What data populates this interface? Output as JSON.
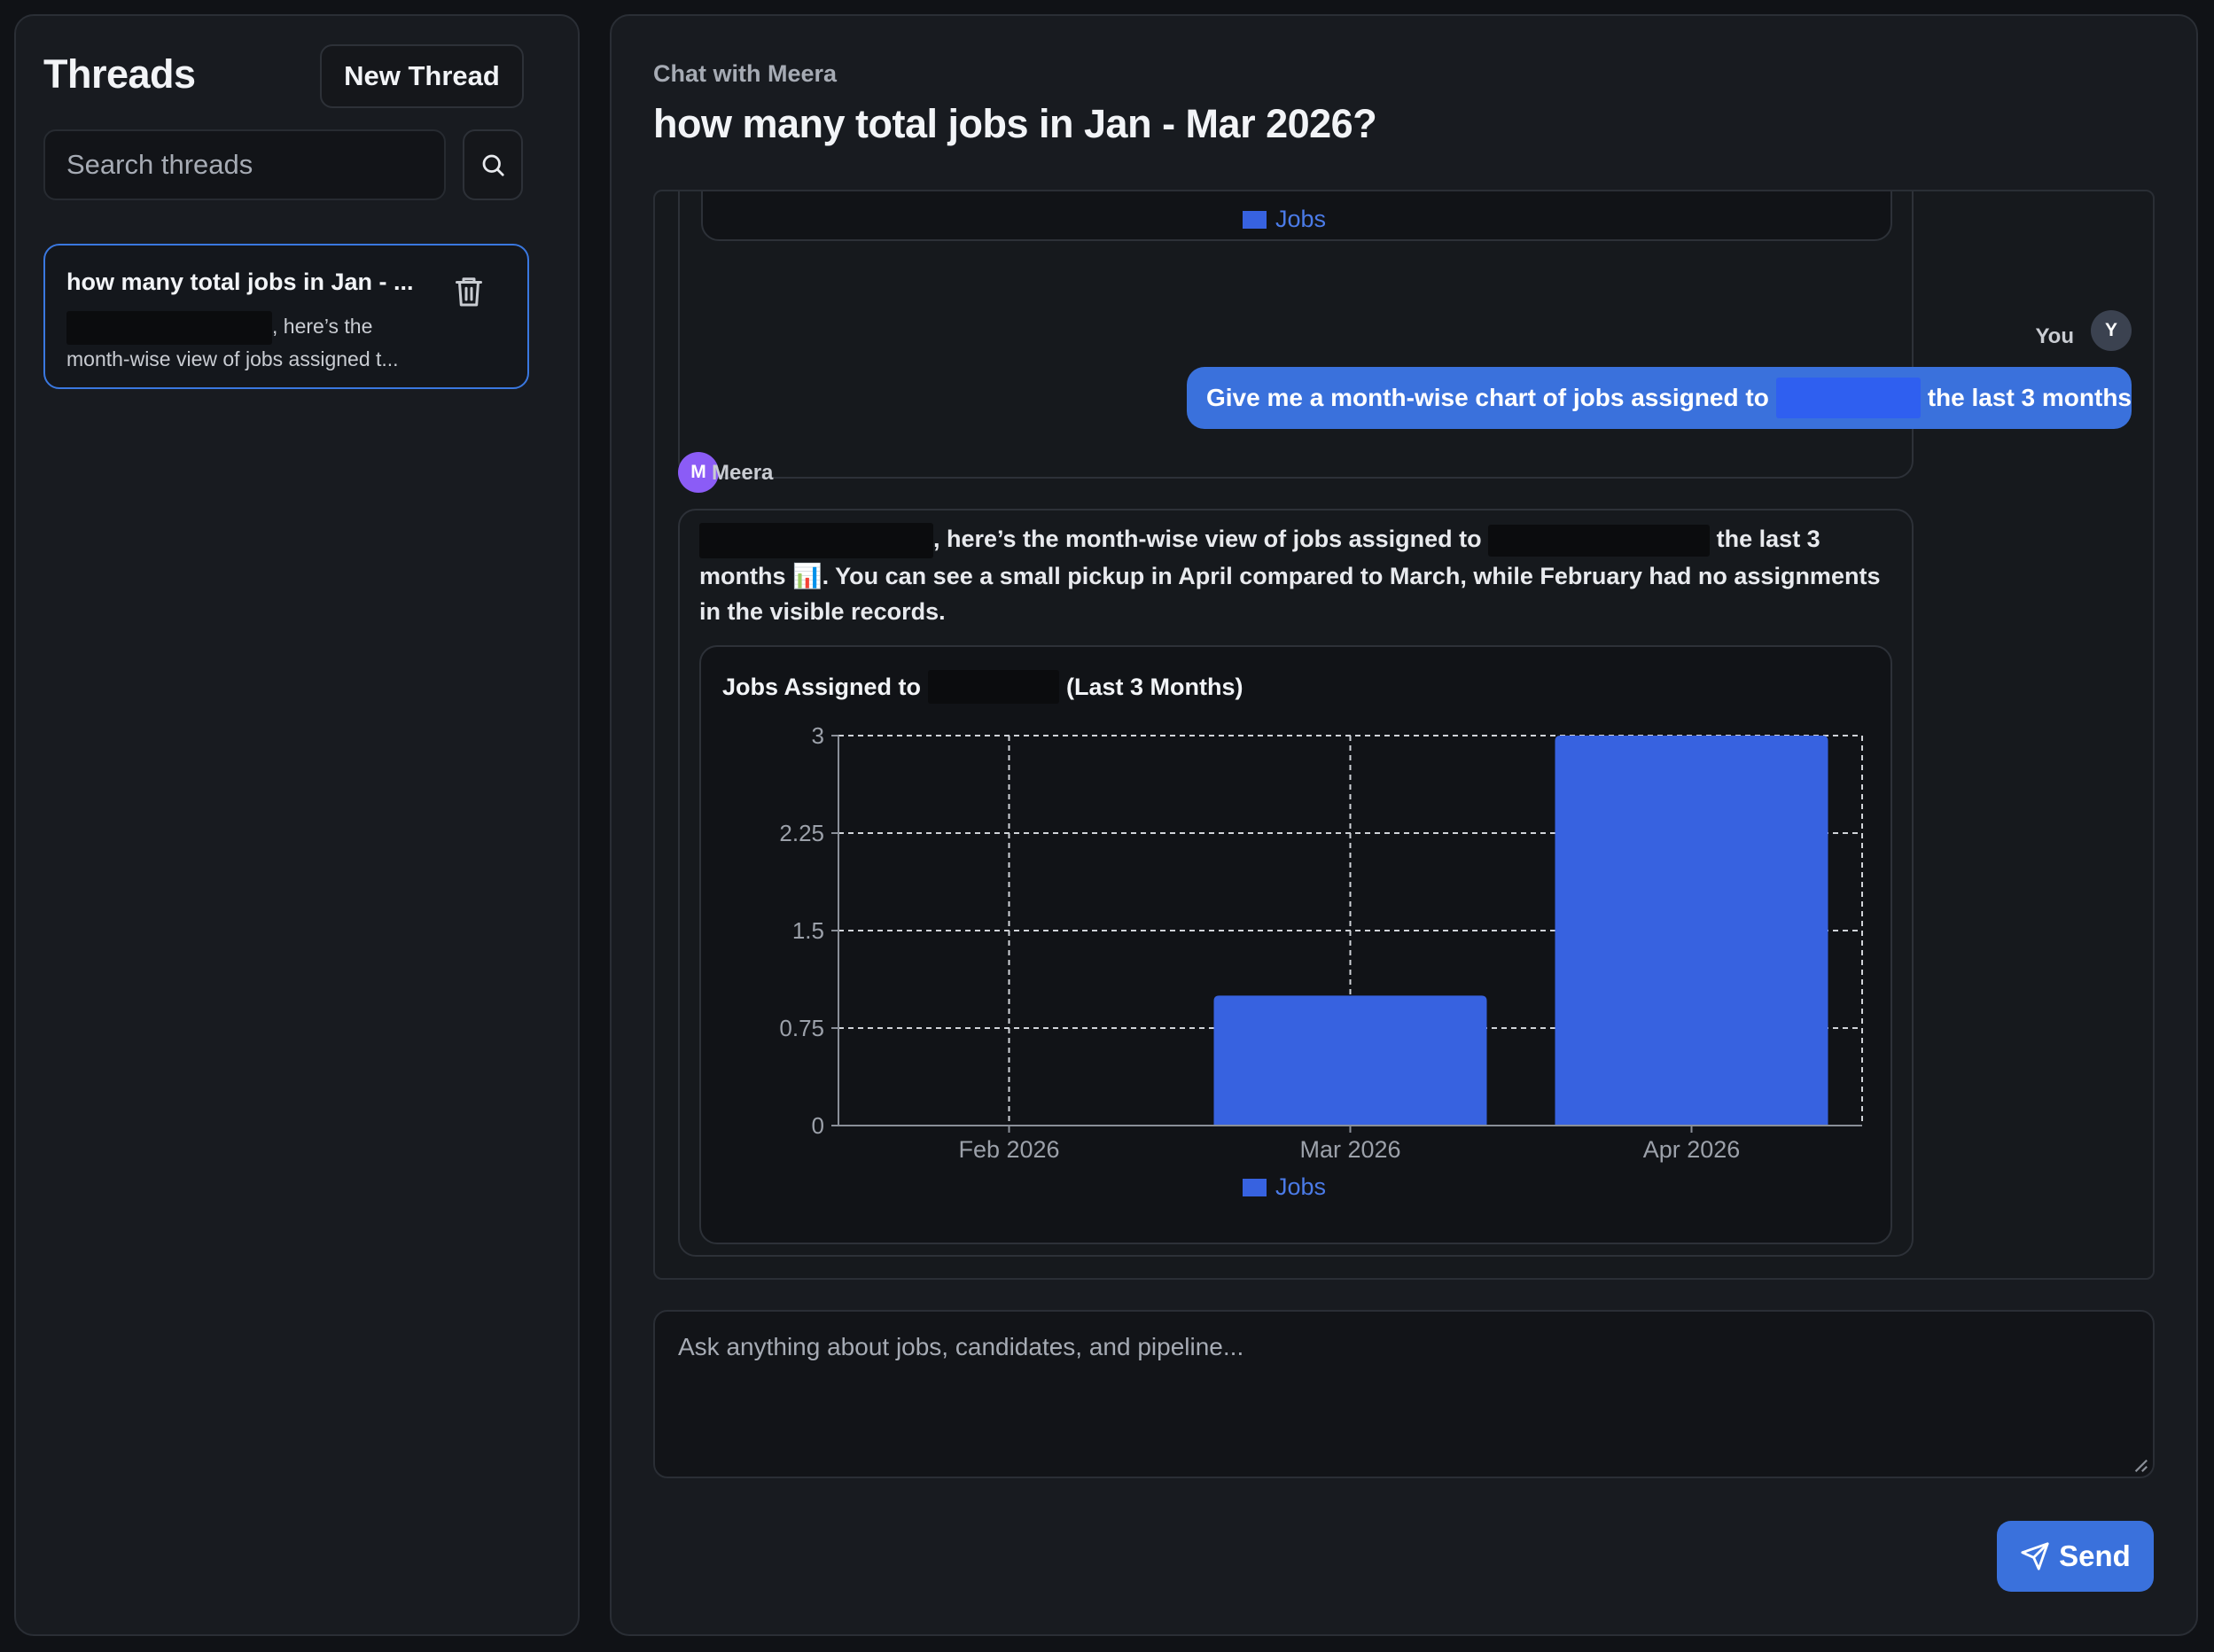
{
  "sidebar": {
    "title": "Threads",
    "new_thread_label": "New Thread",
    "search_placeholder": "Search threads",
    "threads": [
      {
        "title": "how many total jobs in Jan - ...",
        "preview_after_redaction": ", here’s the month-wise view of jobs assigned t..."
      }
    ]
  },
  "header": {
    "subtitle": "Chat with Meera",
    "title": "how many total jobs in Jan - Mar 2026?"
  },
  "messages": {
    "prev_legend_label": "Jobs",
    "user_label": "You",
    "user_avatar": "Y",
    "user_message_before": "Give me a month-wise chart of jobs assigned to",
    "user_message_after": "the last 3 months",
    "assistant_label": "Meera",
    "assistant_avatar": "M",
    "assistant_text_1": ", here’s the month-wise view of jobs assigned to",
    "assistant_text_2": "the last 3 months",
    "assistant_emoji": "📊",
    "assistant_text_3": ". You can see a small pickup in April compared to March, while February had no assignments in the visible records.",
    "chart_title_before": "Jobs Assigned to",
    "chart_title_after": "(Last 3 Months)"
  },
  "composer": {
    "placeholder": "Ask anything about jobs, candidates, and pipeline...",
    "send_label": "Send"
  },
  "colors": {
    "accent": "#3a71dc",
    "bar": "#3762e0",
    "assistant_avatar": "#8b5cf6",
    "user_avatar": "#3b4250"
  },
  "chart_data": {
    "type": "bar",
    "categories": [
      "Feb 2026",
      "Mar 2026",
      "Apr 2026"
    ],
    "series": [
      {
        "name": "Jobs",
        "values": [
          0,
          1,
          3
        ]
      }
    ],
    "ylim": [
      0,
      3
    ],
    "yticks": [
      0,
      0.75,
      1.5,
      2.25,
      3
    ],
    "ytick_labels": [
      "0",
      "0.75",
      "1.5",
      "2.25",
      "3"
    ],
    "grid": true,
    "legend_position": "bottom"
  }
}
